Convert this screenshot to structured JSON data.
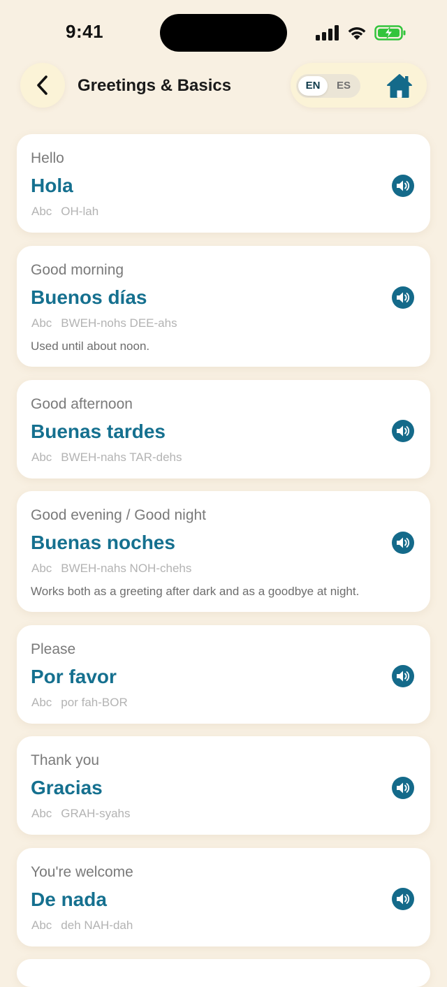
{
  "status": {
    "time": "9:41"
  },
  "header": {
    "title": "Greetings & Basics",
    "lang_en": "EN",
    "lang_es": "ES",
    "active_lang": "EN"
  },
  "colors": {
    "background": "#f8f0e2",
    "accent": "#15708f",
    "speaker": "#146a8a",
    "battery": "#32c43c"
  },
  "phrases": [
    {
      "en": "Hello",
      "es": "Hola",
      "pron_tag": "Abc",
      "pron": "OH-lah",
      "note": ""
    },
    {
      "en": "Good morning",
      "es": "Buenos días",
      "pron_tag": "Abc",
      "pron": "BWEH-nohs DEE-ahs",
      "note": "Used until about noon."
    },
    {
      "en": "Good afternoon",
      "es": "Buenas tardes",
      "pron_tag": "Abc",
      "pron": "BWEH-nahs TAR-dehs",
      "note": ""
    },
    {
      "en": "Good evening / Good night",
      "es": "Buenas noches",
      "pron_tag": "Abc",
      "pron": "BWEH-nahs NOH-chehs",
      "note": "Works both as a greeting after dark and as a goodbye at night."
    },
    {
      "en": "Please",
      "es": "Por favor",
      "pron_tag": "Abc",
      "pron": "por fah-BOR",
      "note": ""
    },
    {
      "en": "Thank you",
      "es": "Gracias",
      "pron_tag": "Abc",
      "pron": "GRAH-syahs",
      "note": ""
    },
    {
      "en": "You're welcome",
      "es": "De nada",
      "pron_tag": "Abc",
      "pron": "deh NAH-dah",
      "note": ""
    }
  ]
}
